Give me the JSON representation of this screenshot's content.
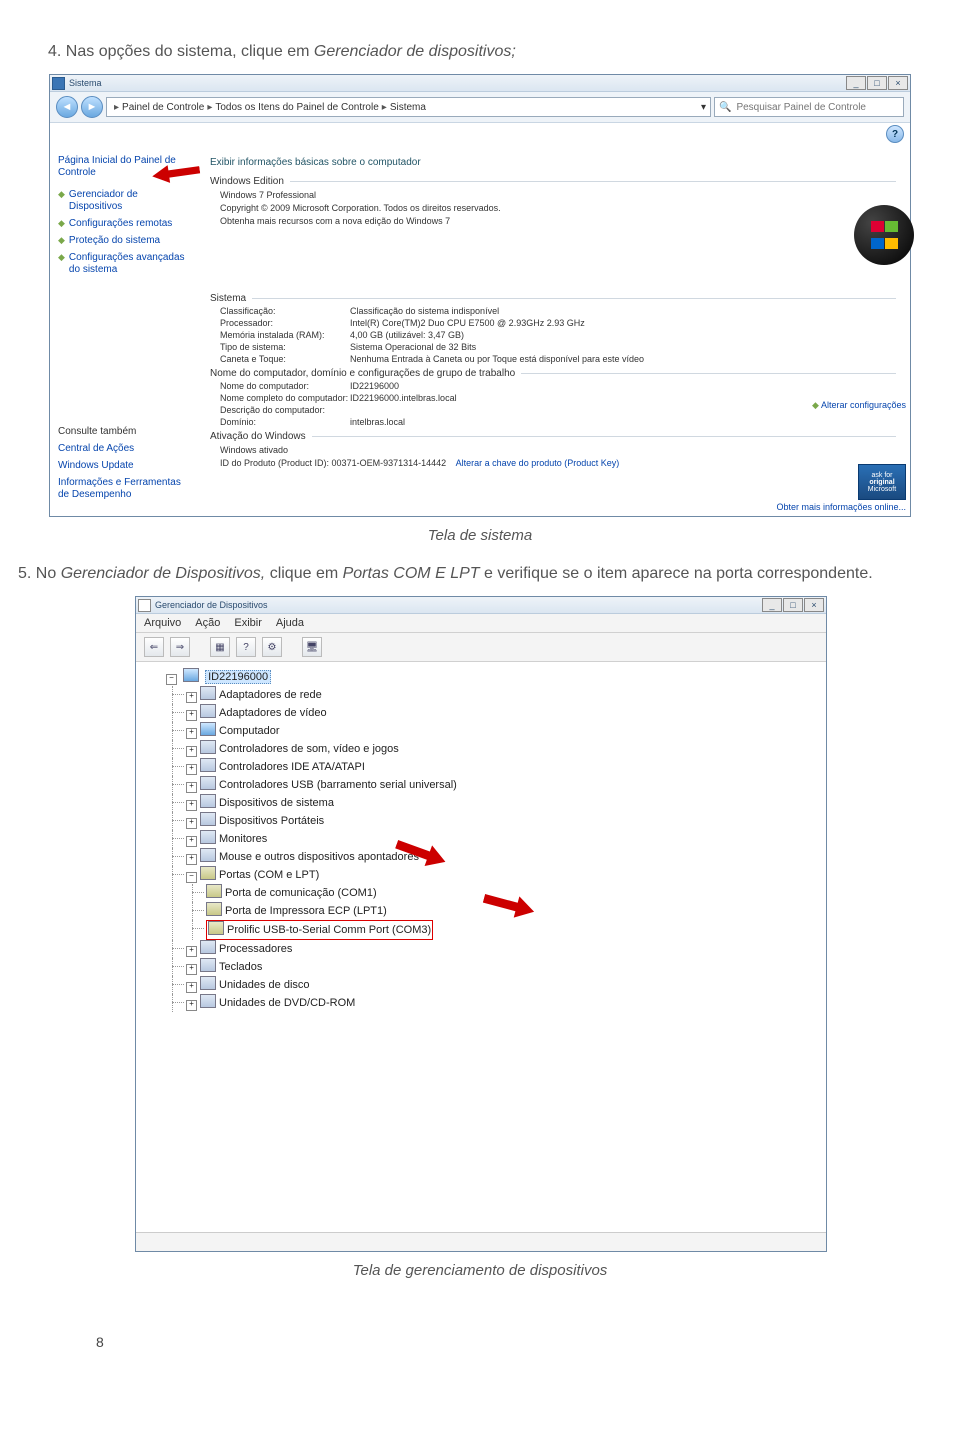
{
  "doc": {
    "instr4_pre": "4. Nas opções do sistema, clique em ",
    "instr4_em": "Gerenciador de dispositivos;",
    "caption1": "Tela de sistema",
    "instr5_pre": "5. No ",
    "instr5_em1": "Gerenciador de Dispositivos,",
    "instr5_mid": " clique em ",
    "instr5_em2": "Portas COM E LPT",
    "instr5_post": " e verifique se o item aparece na porta correspondente.",
    "caption2": "Tela de gerenciamento de dispositivos",
    "page_number": "8"
  },
  "sys": {
    "title": "Sistema",
    "btn_min": "_",
    "btn_max": "□",
    "btn_close": "×",
    "nav_back": "◄",
    "nav_fwd": "►",
    "crumb1": "Painel de Controle",
    "crumb2": "Todos os Itens do Painel de Controle",
    "crumb3": "Sistema",
    "crumb_sep": "▸",
    "search_placeholder": "Pesquisar Painel de Controle",
    "qmark": "?",
    "side_home": "Página Inicial do Painel de Controle",
    "side_l1": "Gerenciador de Dispositivos",
    "side_l2": "Configurações remotas",
    "side_l3": "Proteção do sistema",
    "side_l4": "Configurações avançadas do sistema",
    "side_hdr2": "Consulte também",
    "side_b1": "Central de Ações",
    "side_b2": "Windows Update",
    "side_b3": "Informações e Ferramentas de Desempenho",
    "main_title": "Exibir informações básicas sobre o computador",
    "grp1": "Windows Edition",
    "g1_l1": "Windows 7 Professional",
    "g1_l2": "Copyright © 2009 Microsoft Corporation. Todos os direitos reservados.",
    "g1_l3": "Obtenha mais recursos com a nova edição do Windows 7",
    "grp2": "Sistema",
    "k_class": "Classificação:",
    "v_class": "Classificação do sistema indisponível",
    "k_proc": "Processador:",
    "v_proc": "Intel(R) Core(TM)2 Duo CPU    E7500  @ 2.93GHz  2.93 GHz",
    "k_ram": "Memória instalada (RAM):",
    "v_ram": "4,00 GB (utilizável: 3,47 GB)",
    "k_type": "Tipo de sistema:",
    "v_type": "Sistema Operacional de 32 Bits",
    "k_pen": "Caneta e Toque:",
    "v_pen": "Nenhuma Entrada à Caneta ou por Toque está disponível para este vídeo",
    "grp3": "Nome do computador, domínio e configurações de grupo de trabalho",
    "k_cn": "Nome do computador:",
    "v_cn": "ID22196000",
    "k_fn": "Nome completo do computador:",
    "v_fn": "ID22196000.intelbras.local",
    "k_desc": "Descrição do computador:",
    "k_dom": "Domínio:",
    "v_dom": "intelbras.local",
    "rt_link": "Alterar configurações",
    "grp4": "Ativação do Windows",
    "g4_l1": "Windows ativado",
    "g4_l2a": "ID do Produto (Product ID): 00371-OEM-9371314-14442",
    "g4_l2b": "Alterar a chave do produto (Product Key)",
    "badge1": "ask for",
    "badge2": "original",
    "badge3": "Microsoft",
    "more_info": "Obter mais informações online..."
  },
  "dm": {
    "title": "Gerenciador de Dispositivos",
    "btn_min": "_",
    "btn_max": "□",
    "btn_close": "×",
    "menu": [
      "Arquivo",
      "Ação",
      "Exibir",
      "Ajuda"
    ],
    "tb_back": "⇐",
    "tb_fwd": "⇒",
    "tb_b1": "▦",
    "tb_b2": "?",
    "tb_b3": "⚙",
    "tb_b4": "🖥",
    "root": "ID22196000",
    "n1": "Adaptadores de rede",
    "n2": "Adaptadores de vídeo",
    "n3": "Computador",
    "n4": "Controladores de som, vídeo e jogos",
    "n5": "Controladores IDE ATA/ATAPI",
    "n6": "Controladores USB (barramento serial universal)",
    "n7": "Dispositivos de sistema",
    "n8": "Dispositivos Portáteis",
    "n9": "Monitores",
    "n10": "Mouse e outros dispositivos apontadores",
    "n11": "Portas (COM e LPT)",
    "n11a": "Porta de comunicação (COM1)",
    "n11b": "Porta de Impressora ECP (LPT1)",
    "n11c": "Prolific USB-to-Serial Comm Port (COM3)",
    "n12": "Processadores",
    "n13": "Teclados",
    "n14": "Unidades de disco",
    "n15": "Unidades de DVD/CD-ROM",
    "exp_plus": "+",
    "exp_minus": "−"
  }
}
